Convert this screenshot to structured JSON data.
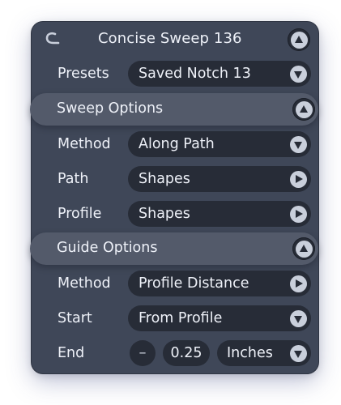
{
  "window": {
    "title": "Concise Sweep 136",
    "logo_icon": "hook-logo-icon",
    "collapse_icon": "collapse-up-icon"
  },
  "presets": {
    "label": "Presets",
    "value": "Saved Notch 13"
  },
  "sweep_options": {
    "title": "Sweep Options",
    "method": {
      "label": "Method",
      "value": "Along Path"
    },
    "path": {
      "label": "Path",
      "value": "Shapes"
    },
    "profile": {
      "label": "Profile",
      "value": "Shapes"
    }
  },
  "guide_options": {
    "title": "Guide Options",
    "method": {
      "label": "Method",
      "value": "Profile Distance"
    },
    "start": {
      "label": "Start",
      "value": "From Profile"
    },
    "end": {
      "label": "End",
      "minus": "–",
      "value": "0.25",
      "unit": "Inches"
    }
  },
  "colors": {
    "panel_bg": "#3f4758",
    "section_bg": "#535a6a",
    "field_bg": "#272c37",
    "button_fg": "#c9cfdb",
    "text": "#eef1f8"
  }
}
